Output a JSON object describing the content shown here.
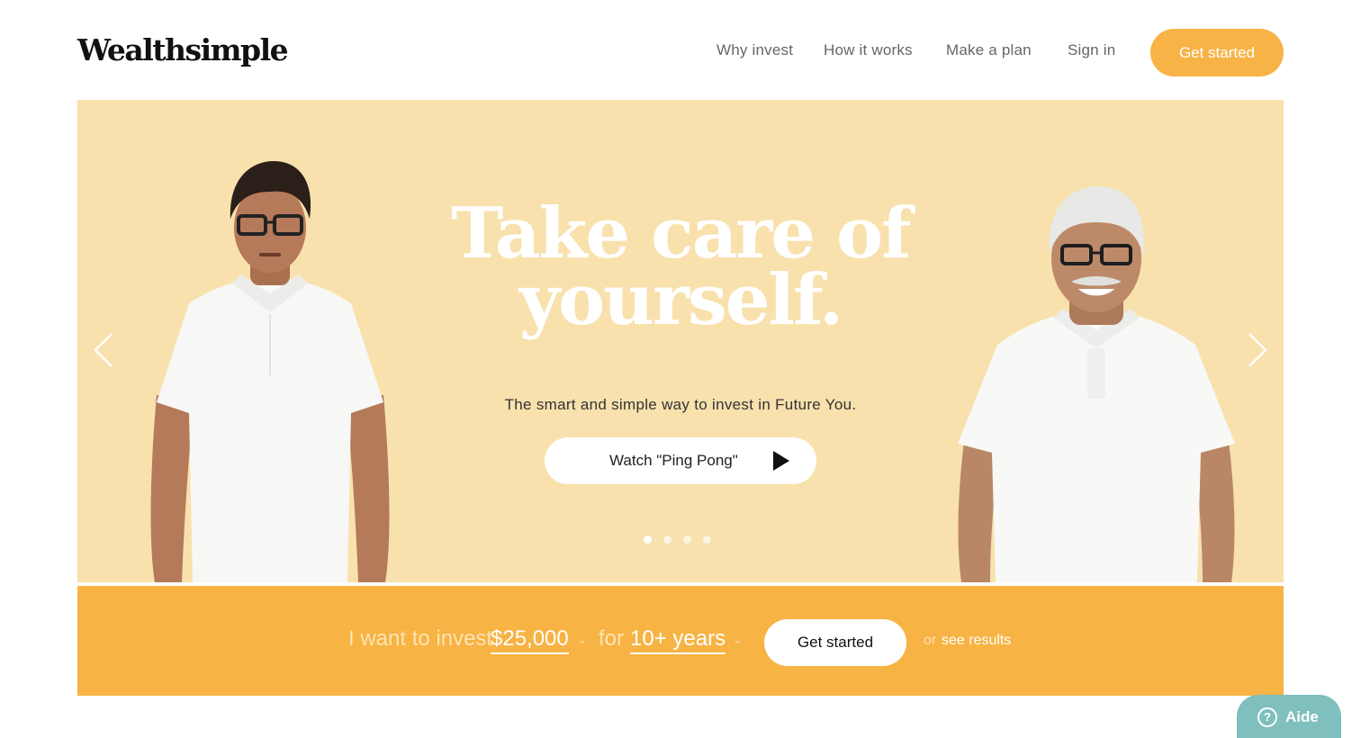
{
  "header": {
    "logo": "Wealthsimple",
    "nav": [
      "Why invest",
      "How it works",
      "Make a plan",
      "Sign in"
    ],
    "cta": "Get started"
  },
  "hero": {
    "headline_line1": "Take care of",
    "headline_line2": "yourself.",
    "subline": "The smart and simple way to invest in Future You.",
    "watch_button": "Watch \"Ping Pong\"",
    "slide_count": 4,
    "active_slide": 1,
    "background_color": "#f8e1ad"
  },
  "invest_bar": {
    "text_prefix": "I want to invest",
    "amount": "$25,000",
    "text_for": "for",
    "years": "10+ years",
    "cta": "Get started",
    "or_text": "or",
    "see_results": "see results",
    "background_color": "#f7b343"
  },
  "help_widget": {
    "label": "Aide",
    "icon": "?"
  },
  "colors": {
    "accent": "#f7b345",
    "help": "#7fbfbd"
  }
}
